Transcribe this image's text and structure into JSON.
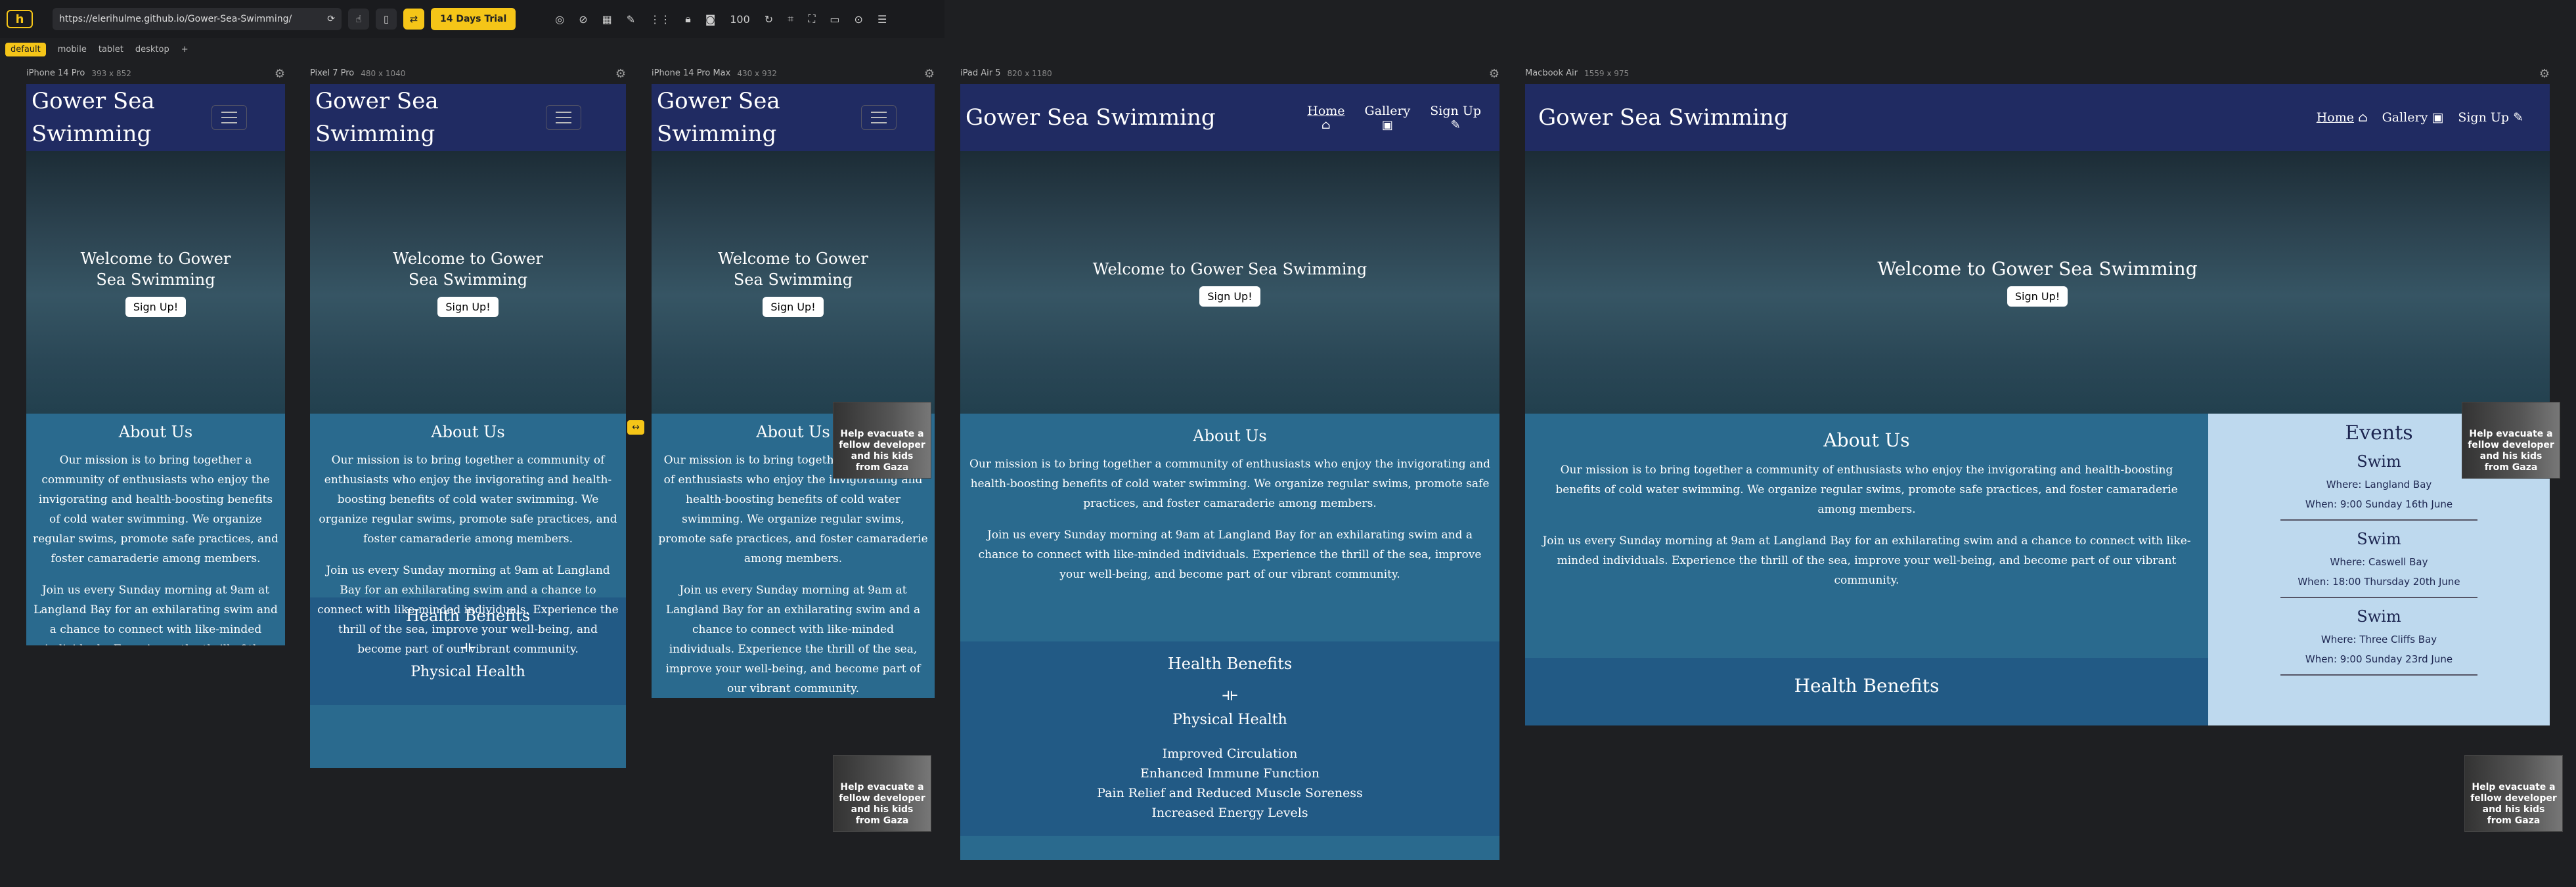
{
  "toolbar": {
    "logo": "h",
    "url": "https://elerihulme.github.io/Gower-Sea-Swimming/",
    "trial_label": "14 Days Trial",
    "zoom": "100"
  },
  "views": [
    "default",
    "mobile",
    "tablet",
    "desktop"
  ],
  "devices": [
    {
      "name": "iPhone 14 Pro",
      "dim": "393 x 852"
    },
    {
      "name": "Pixel 7 Pro",
      "dim": "480 x 1040"
    },
    {
      "name": "iPhone 14 Pro Max",
      "dim": "430 x 932"
    },
    {
      "name": "iPad Air 5",
      "dim": "820 x 1180"
    },
    {
      "name": "Macbook Air",
      "dim": "1559 x 975"
    }
  ],
  "site": {
    "title": "Gower Sea Swimming",
    "title_line1": "Gower Sea",
    "title_line2": "Swimming",
    "hero": "Welcome to Gower Sea Swimming",
    "hero_line1": "Welcome to Gower",
    "hero_line2": "Sea Swimming",
    "hero_button": "Sign Up!",
    "nav": {
      "home": "Home",
      "gallery": "Gallery",
      "signup": "Sign Up"
    },
    "about_title": "About Us",
    "about_p1": "Our mission is to bring together a community of enthusiasts who enjoy the invigorating and health-boosting benefits of cold water swimming. We organize regular swims, promote safe practices, and foster camaraderie among members.",
    "about_p2": "Join us every Sunday morning at 9am at Langland Bay for an exhilarating swim and a chance to connect with like-minded individuals. Experience the thrill of the sea, improve your well-being, and become part of our vibrant community.",
    "health_title": "Health Benefits",
    "physical_title": "Physical Health",
    "benefits": [
      "Improved Circulation",
      "Enhanced Immune Function",
      "Pain Relief and Reduced Muscle Soreness",
      "Increased Energy Levels"
    ],
    "events_title": "Events",
    "events": [
      {
        "title": "Swim",
        "where": "Where: Langland Bay",
        "when": "When: 9:00 Sunday 16th June"
      },
      {
        "title": "Swim",
        "where": "Where: Caswell Bay",
        "when": "When: 18:00 Thursday 20th June"
      },
      {
        "title": "Swim",
        "where": "Where: Three Cliffs Bay",
        "when": "When: 9:00 Sunday 23rd June"
      }
    ]
  },
  "ad": {
    "text": "Help evacuate a fellow developer and his kids from Gaza"
  },
  "colors": {
    "header": "#202b62",
    "about": "#2a6a8e",
    "health": "#225a85",
    "events": "#bed9ee",
    "accent": "#f5c518"
  }
}
